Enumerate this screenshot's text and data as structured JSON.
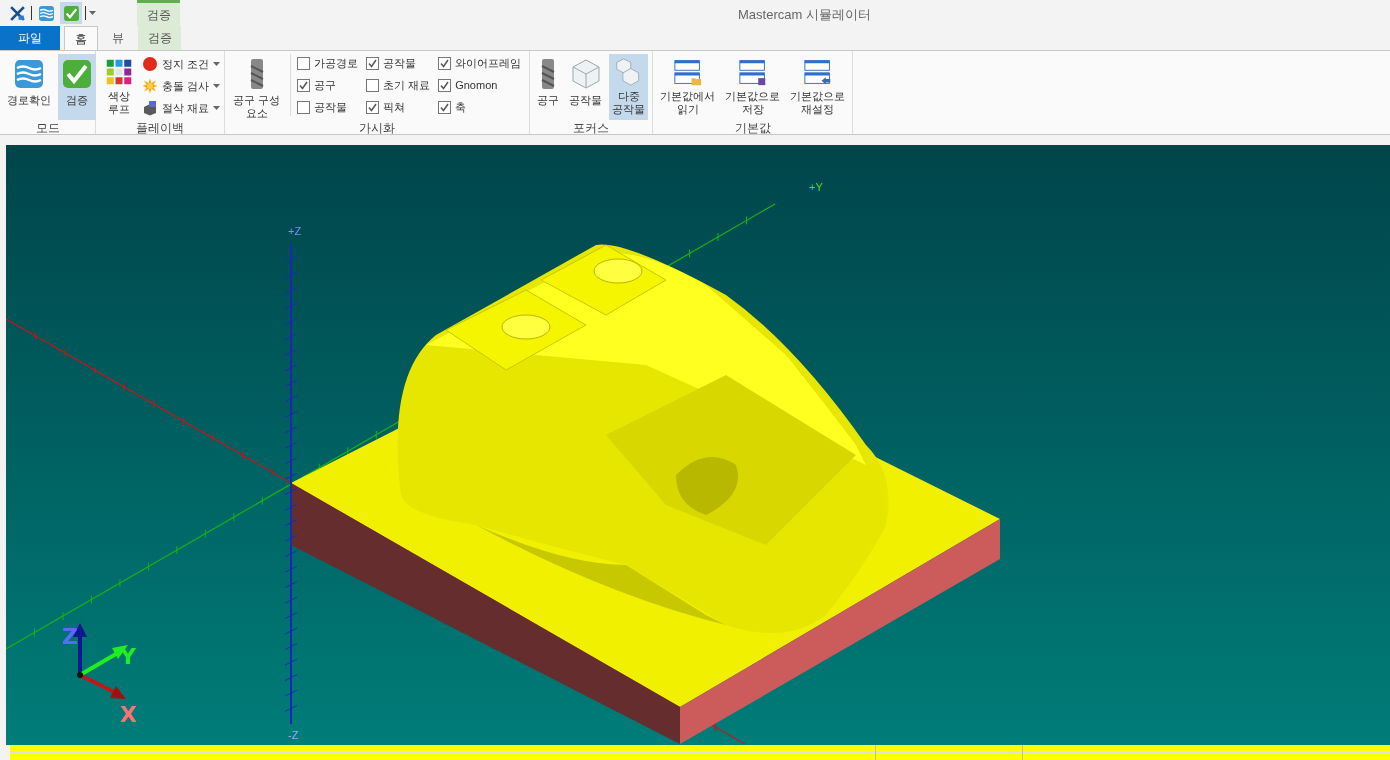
{
  "quick_access": [
    {
      "kind": "app"
    },
    {
      "kind": "waves",
      "selected": false
    },
    {
      "kind": "check",
      "selected": true
    }
  ],
  "contextual_group": {
    "label": "검증"
  },
  "window": {
    "title": "Mastercam 시뮬레이터"
  },
  "tabs": [
    {
      "label": "파일",
      "kind": "file",
      "selected": false
    },
    {
      "label": "홈",
      "kind": "tab",
      "selected": true
    },
    {
      "label": "뷰",
      "kind": "tab",
      "selected": false
    },
    {
      "label": "검증",
      "kind": "context",
      "selected": false
    }
  ],
  "ribbon": {
    "mode": {
      "label": "모드",
      "buttons": [
        {
          "label": "경로확인",
          "selected": false
        },
        {
          "label": "검증",
          "selected": true
        }
      ]
    },
    "playback": {
      "label": "플레이백",
      "large": {
        "label": "색상\n루프"
      },
      "items": [
        {
          "label": "정지 조건"
        },
        {
          "label": "충돌 검사"
        },
        {
          "label": "절삭 재료"
        }
      ]
    },
    "visual": {
      "label": "가시화",
      "large": {
        "label": "공구 구성\n요소"
      },
      "columns": [
        [
          {
            "label": "가공경로",
            "checked": false
          },
          {
            "label": "공구",
            "checked": true
          },
          {
            "label": "공작물",
            "checked": false
          }
        ],
        [
          {
            "label": "공작물",
            "checked": true
          },
          {
            "label": "초기 재료",
            "checked": false
          },
          {
            "label": "픽쳐",
            "checked": true
          }
        ],
        [
          {
            "label": "와이어프레임",
            "checked": true
          },
          {
            "label": "Gnomon",
            "checked": true
          },
          {
            "label": "축",
            "checked": true
          }
        ]
      ]
    },
    "focus": {
      "label": "포커스",
      "buttons": [
        {
          "label": "공구",
          "selected": false
        },
        {
          "label": "공작물",
          "selected": false
        },
        {
          "label": "다중\n공작물",
          "selected": true
        }
      ]
    },
    "defaults": {
      "label": "기본값",
      "buttons": [
        {
          "label": "기본값에서\n읽기"
        },
        {
          "label": "기본값으로\n저장"
        },
        {
          "label": "기본값으로\n재설정"
        }
      ]
    }
  },
  "viewport": {
    "axis_labels": [
      {
        "label": "+Z",
        "kind": "zpos"
      },
      {
        "label": "-Z",
        "kind": "zneg"
      },
      {
        "label": "+Y",
        "kind": "ypos"
      }
    ],
    "gnomon": [
      {
        "label": "Z",
        "kind": "z"
      },
      {
        "label": "Y",
        "kind": "y"
      },
      {
        "label": "X",
        "kind": "x"
      }
    ]
  }
}
